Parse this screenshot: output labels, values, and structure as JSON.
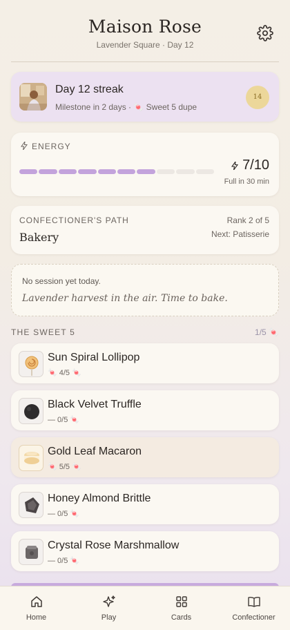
{
  "header": {
    "title": "Maison Rose",
    "subtitle": "Lavender Square · Day 12"
  },
  "streak": {
    "title": "Day 12 streak",
    "subtitle": "Milestone in 2 days · 🍬 Sweet 5 dupe",
    "badge": "14"
  },
  "energy": {
    "label": "ENERGY",
    "value": "7/10",
    "current": 7,
    "max": 10,
    "refill_text": "Full in 30 min"
  },
  "path": {
    "label": "CONFECTIONER'S PATH",
    "current": "Bakery",
    "rank": "Rank 2 of 5",
    "next": "Next: Patisserie"
  },
  "session": {
    "status": "No session yet today.",
    "quote": "Lavender harvest in the air. Time to bake."
  },
  "sweet5": {
    "title": "THE SWEET 5",
    "count": "1/5 🍬",
    "items": [
      {
        "name": "Sun Spiral Lollipop",
        "progress": "🍬 4/5 🍬",
        "icon": "lollipop-icon"
      },
      {
        "name": "Black Velvet Truffle",
        "progress": "— 0/5 🍬",
        "icon": "truffle-icon"
      },
      {
        "name": "Gold Leaf Macaron",
        "progress": "🍬 5/5 🍬",
        "icon": "macaron-icon"
      },
      {
        "name": "Honey Almond Brittle",
        "progress": "— 0/5 🍬",
        "icon": "brittle-icon"
      },
      {
        "name": "Crystal Rose Marshmallow",
        "progress": "— 0/5 🍬",
        "icon": "marshmallow-icon"
      }
    ]
  },
  "tabs": [
    {
      "label": "Home",
      "icon": "home-icon"
    },
    {
      "label": "Play",
      "icon": "sparkle-icon"
    },
    {
      "label": "Cards",
      "icon": "grid-icon"
    },
    {
      "label": "Confectioner",
      "icon": "book-icon"
    }
  ],
  "colors": {
    "accent": "#c3a3dc",
    "streak_bg": "#ece1f1",
    "badge": "#ecd79a"
  }
}
